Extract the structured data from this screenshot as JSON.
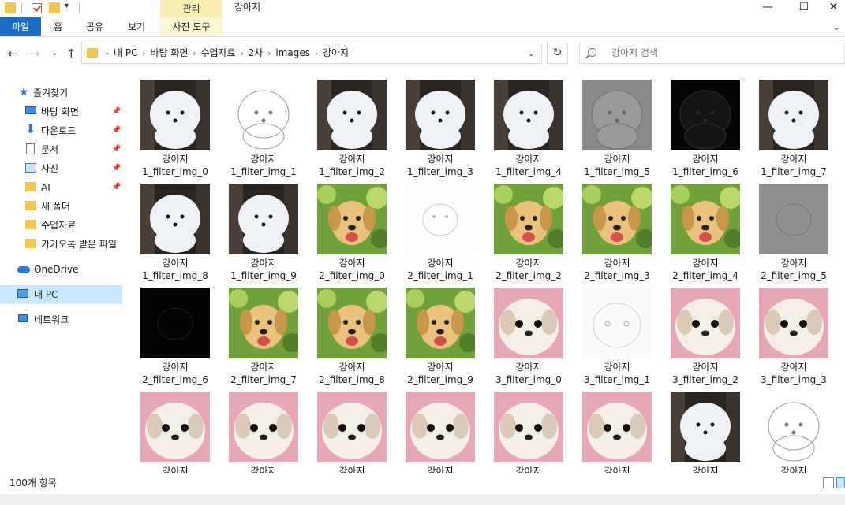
{
  "window": {
    "title": "강아지",
    "context_tab": "관리",
    "minimize": "—",
    "maximize": "☐",
    "close": "✕"
  },
  "ribbon": {
    "tabs": [
      "파일",
      "홈",
      "공유",
      "보기"
    ],
    "context_tool": "사진 도구"
  },
  "address": {
    "breadcrumb": [
      "내 PC",
      "바탕 화면",
      "수업자료",
      "2차",
      "images",
      "강아지"
    ]
  },
  "search": {
    "placeholder": "강아지 검색"
  },
  "nav": {
    "quick_access": "즐겨찾기",
    "items": [
      "바탕 화면",
      "다운로드",
      "문서",
      "사진",
      "AI",
      "새 폴더",
      "수업자료",
      "카카오톡 받은 파일"
    ],
    "onedrive": "OneDrive",
    "this_pc": "내 PC",
    "network": "네트워크"
  },
  "files": {
    "prefix": "강아지",
    "names": [
      "1_filter_img_0",
      "1_filter_img_1",
      "1_filter_img_2",
      "1_filter_img_3",
      "1_filter_img_4",
      "1_filter_img_5",
      "1_filter_img_6",
      "1_filter_img_7",
      "1_filter_img_8",
      "1_filter_img_9",
      "2_filter_img_0",
      "2_filter_img_1",
      "2_filter_img_2",
      "2_filter_img_3",
      "2_filter_img_4",
      "2_filter_img_5",
      "2_filter_img_6",
      "2_filter_img_7",
      "2_filter_img_8",
      "2_filter_img_9",
      "3_filter_img_0",
      "3_filter_img_1",
      "3_filter_img_2",
      "3_filter_img_3"
    ]
  },
  "status": {
    "count": "100개 항목"
  },
  "colors": {
    "accent": "#1b6ec2",
    "context_tab": "#f9efb3",
    "selected": "#cce8ff",
    "folder": "#f3c64d"
  }
}
